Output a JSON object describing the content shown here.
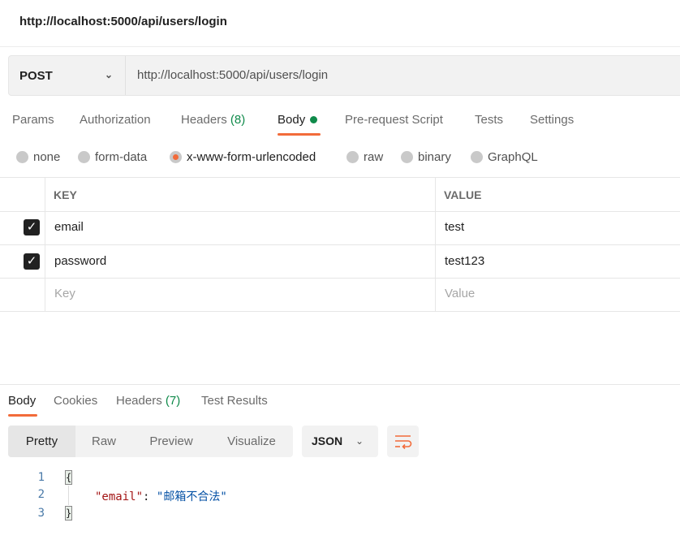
{
  "title": "http://localhost:5000/api/users/login",
  "request": {
    "method": "POST",
    "url": "http://localhost:5000/api/users/login"
  },
  "req_tabs": {
    "params": "Params",
    "authorization": "Authorization",
    "headers": "Headers",
    "headers_count": "(8)",
    "body": "Body",
    "prerequest": "Pre-request Script",
    "tests": "Tests",
    "settings": "Settings"
  },
  "body_types": {
    "options": [
      "none",
      "form-data",
      "x-www-form-urlencoded",
      "raw",
      "binary",
      "GraphQL"
    ],
    "selected": "x-www-form-urlencoded"
  },
  "table": {
    "headers": [
      "KEY",
      "VALUE"
    ],
    "rows": [
      {
        "checked": true,
        "key": "email",
        "value": "test"
      },
      {
        "checked": true,
        "key": "password",
        "value": "test123"
      }
    ],
    "placeholder_key": "Key",
    "placeholder_value": "Value"
  },
  "resp_tabs": {
    "body": "Body",
    "cookies": "Cookies",
    "headers": "Headers",
    "headers_count": "(7)",
    "tests": "Test Results"
  },
  "view_modes": [
    "Pretty",
    "Raw",
    "Preview",
    "Visualize"
  ],
  "format": "JSON",
  "response_code": {
    "line_numbers": [
      "1",
      "2",
      "3"
    ],
    "open": "{",
    "key": "\"email\"",
    "colon": ":",
    "value": "\"邮箱不合法\"",
    "close": "}"
  },
  "colors": {
    "accent": "#f26b3a",
    "green": "#0f8a4a",
    "json_key": "#a31515",
    "json_value": "#0451a5"
  }
}
